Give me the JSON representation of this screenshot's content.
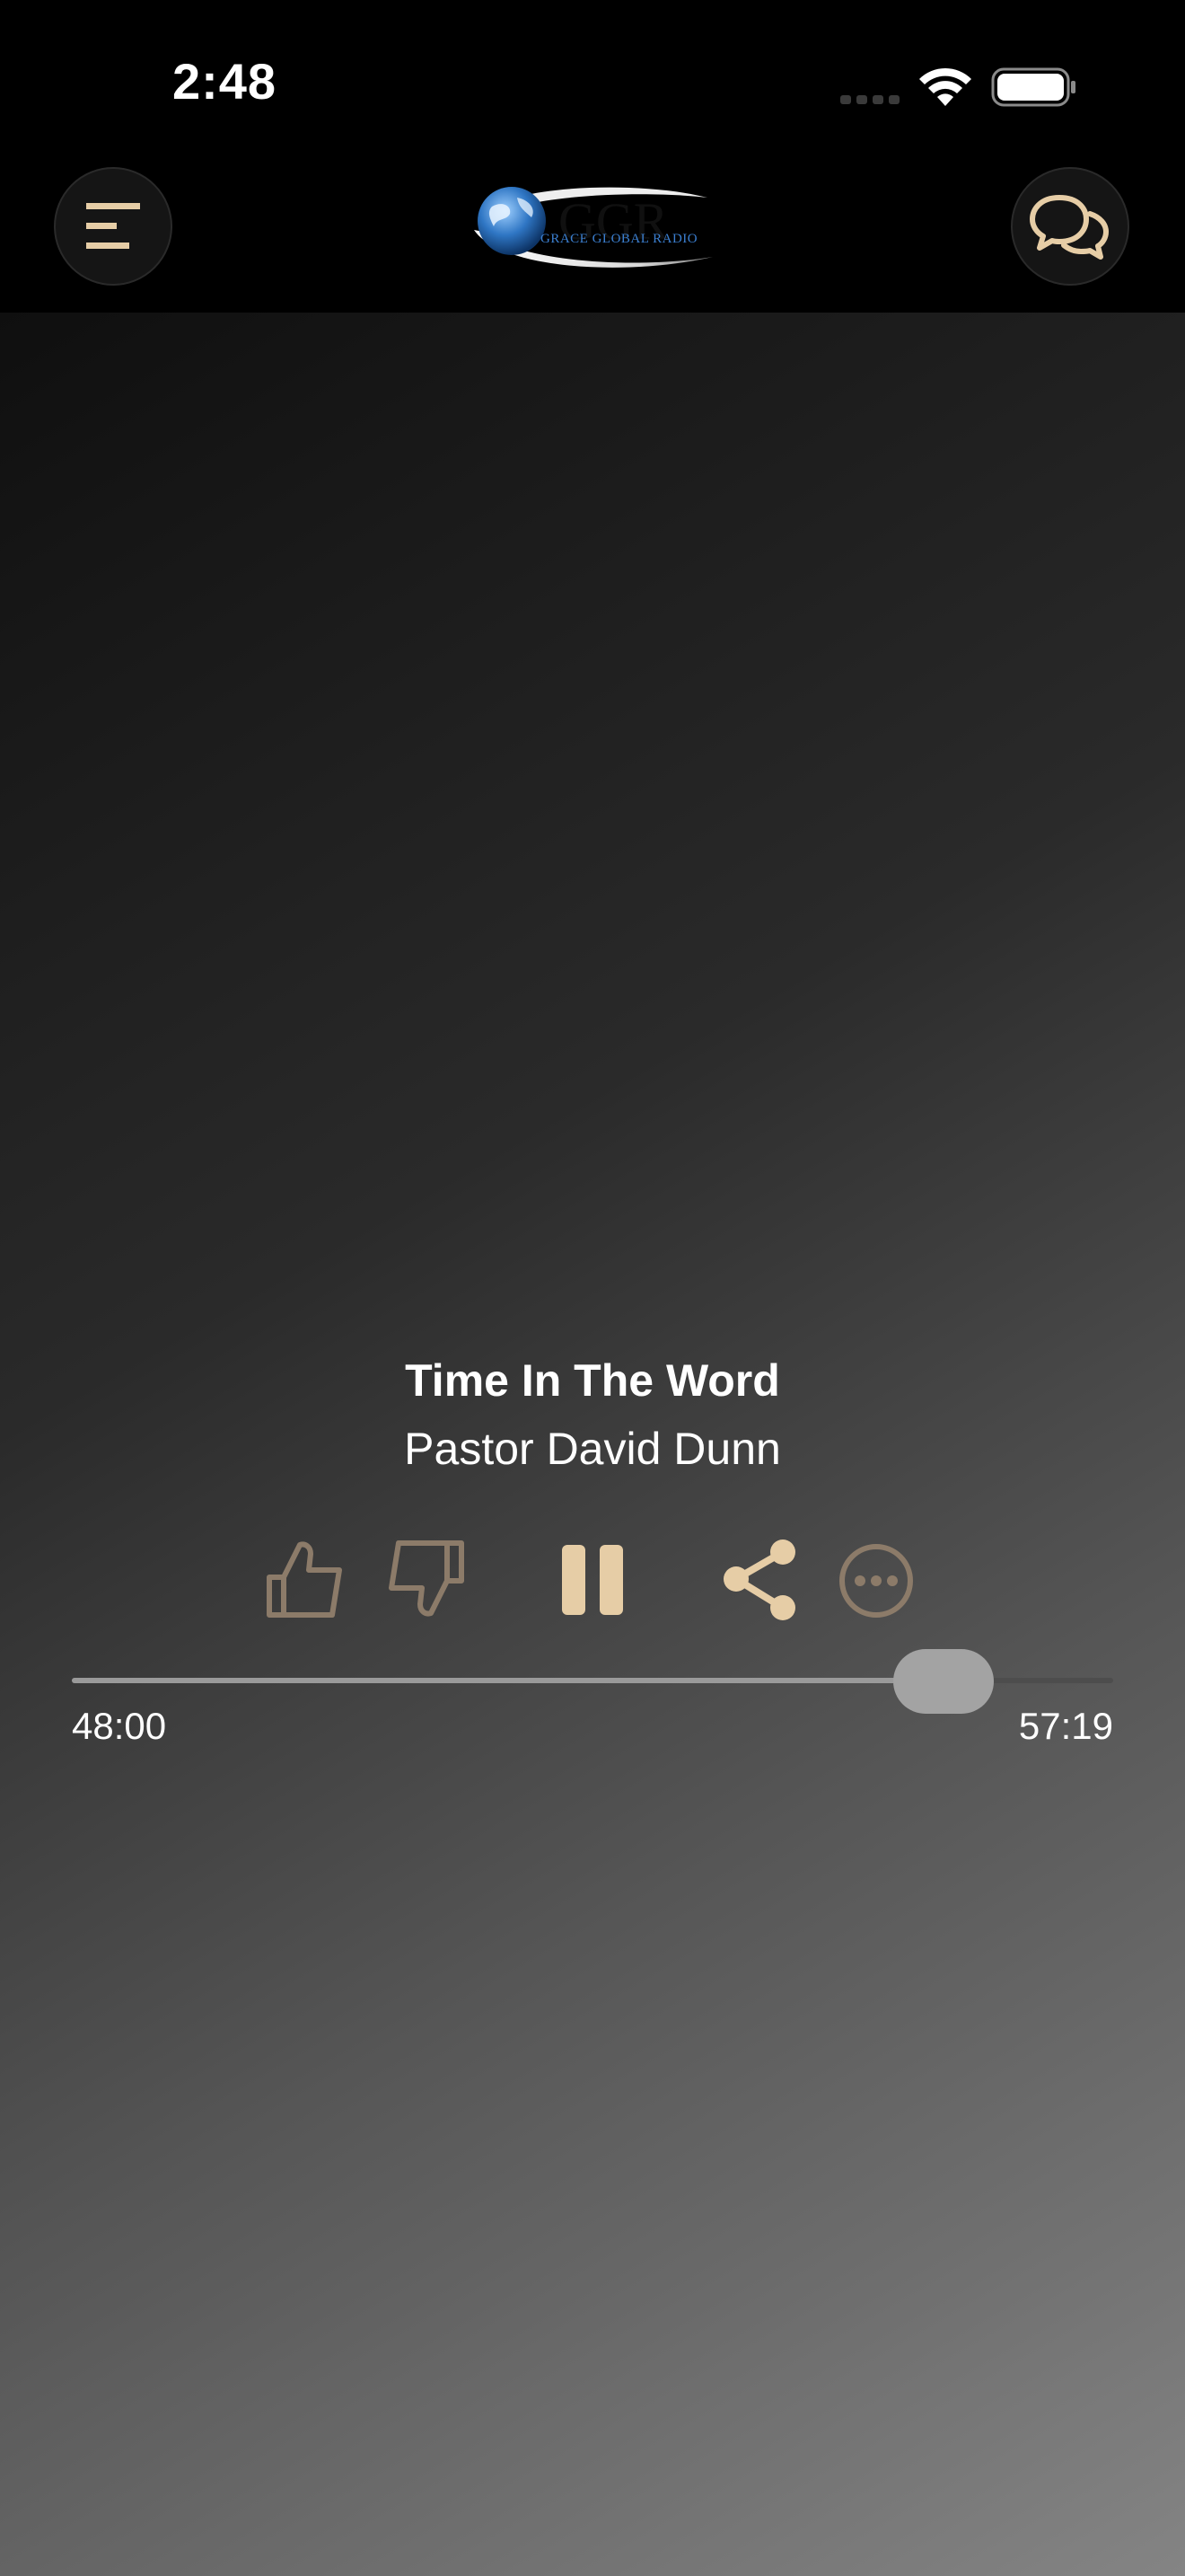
{
  "status_bar": {
    "time": "2:48"
  },
  "header": {
    "logo_alt": "GGR Grace Global Radio",
    "logo_text": "GGR",
    "logo_subtext": "GRACE GLOBAL RADIO",
    "menu_icon": "menu-icon",
    "chat_icon": "chat-bubbles-icon"
  },
  "now_playing": {
    "title": "Time In The Word",
    "artist": "Pastor David Dunn"
  },
  "controls": {
    "like_icon": "thumbs-up-icon",
    "dislike_icon": "thumbs-down-icon",
    "play_state_icon": "pause-icon",
    "share_icon": "share-icon",
    "more_icon": "more-icon"
  },
  "progress": {
    "elapsed": "48:00",
    "total": "57:19",
    "fraction": 0.837
  },
  "colors": {
    "accent": "#e6cda6",
    "accent_muted": "#8c7b69",
    "background_top": "#000000",
    "text": "#ffffff"
  }
}
